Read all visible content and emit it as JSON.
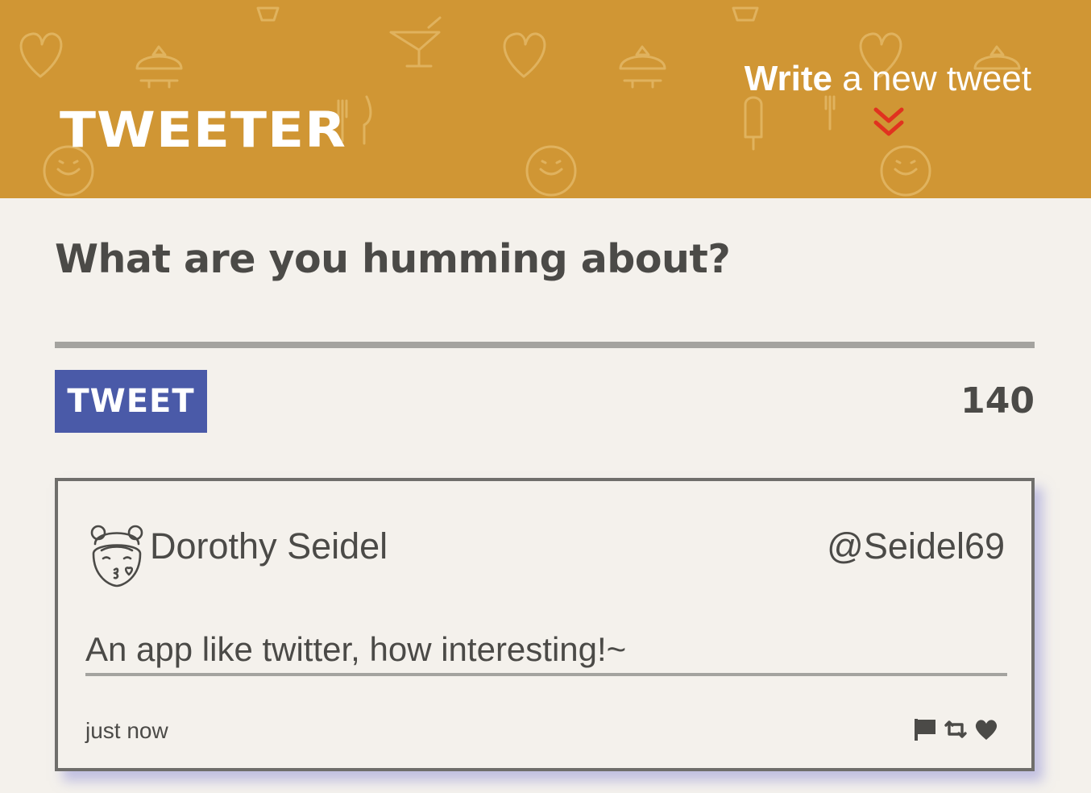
{
  "nav": {
    "brand": "TWEETER",
    "compose_toggle": {
      "strong": "Write",
      "rest": " a new tweet"
    },
    "accent_color": "#d09634",
    "chevron_color": "#e1321f"
  },
  "composer": {
    "prompt": "What are you humming about?",
    "input_value": "",
    "button_label": "TWEET",
    "button_color": "#4a5aa8",
    "char_counter": "140"
  },
  "tweets": [
    {
      "name": "Dorothy Seidel",
      "handle": "@Seidel69",
      "text": "An app like twitter, how interesting!~",
      "time": "just now",
      "avatar_icon": "girl-avatar-icon",
      "actions": [
        "flag-icon",
        "retweet-icon",
        "heart-icon"
      ]
    }
  ]
}
